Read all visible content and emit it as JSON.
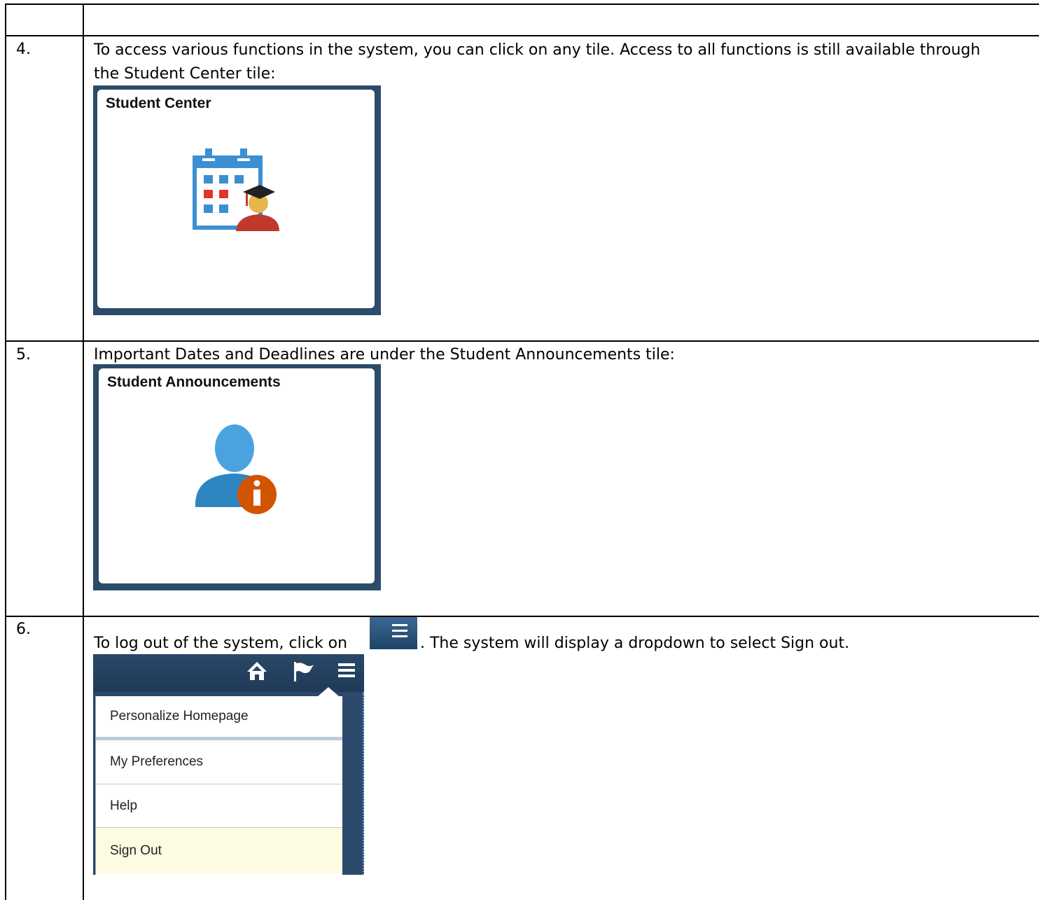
{
  "rows": [
    {
      "number": "4.",
      "line1": "To access various functions in the system, you can click on any tile.  Access to all functions is still available through",
      "line2": "the Student Center tile:",
      "tile_title": "Student Center",
      "tile_icon": "student-center-calendar-graduate-icon"
    },
    {
      "number": "5.",
      "line1": "Important Dates and Deadlines are under the Student Announcements tile:",
      "tile_title": "Student Announcements",
      "tile_icon": "person-info-icon"
    },
    {
      "number": "6.",
      "text_before": "To log out of the system, click on",
      "text_after": ".  The system will display a dropdown to select Sign out.",
      "inline_icon": "hamburger-menu-icon",
      "toolbar_icons": [
        "home-icon",
        "flag-icon",
        "hamburger-menu-icon"
      ],
      "menu_items": [
        "Personalize Homepage",
        "My Preferences",
        "Help",
        "Sign Out"
      ],
      "highlighted_item": "Sign Out"
    }
  ],
  "colors": {
    "tile_frame": "#2c4b6a",
    "menu_highlight": "#fdfbe2",
    "calendar_blue": "#3c8fd1",
    "calendar_red": "#e0352b",
    "person_blue": "#4aa3df",
    "info_orange": "#d35400"
  }
}
